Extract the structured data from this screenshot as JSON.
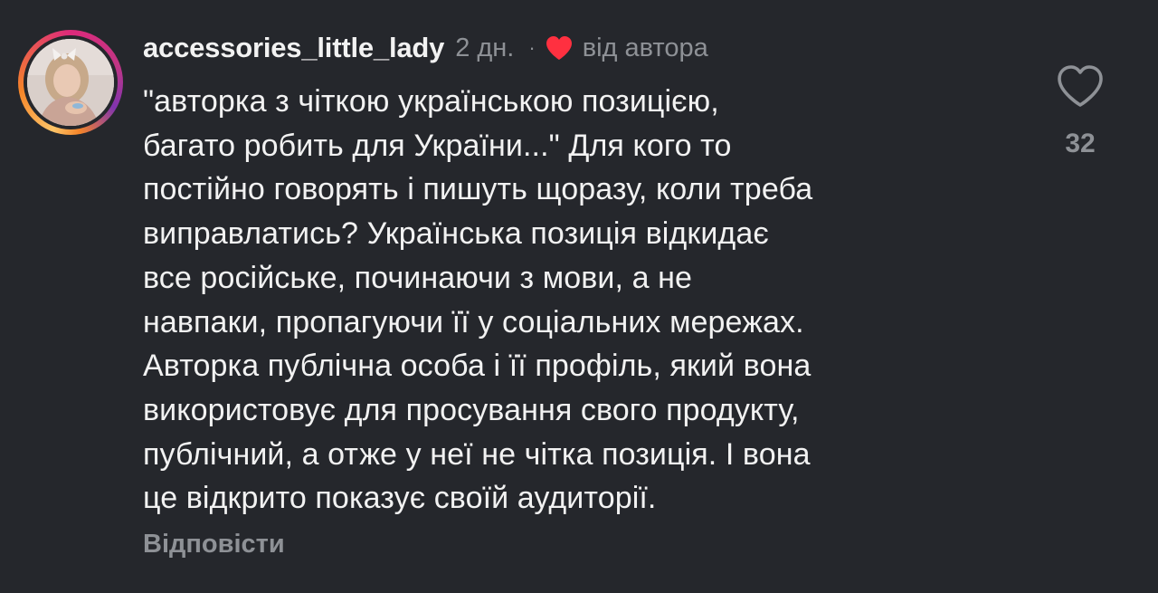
{
  "comment": {
    "username": "accessories_little_lady",
    "timestamp": "2 дн.",
    "separator": "·",
    "author_like_label": "від автора",
    "text": "\"авторка з чіткою українською позицією,\nбагато робить для України...\" Для кого то\nпостійно говорять і пишуть щоразу, коли треба\nвиправлатись? Українська позиція відкидає\nвсе російське, починаючи з мови, а не\nнавпаки, пропагуючи її у соціальних мережах.\nАвторка публічна особа і її профіль, який вона\nвикористовує для просування свого продукту,\nпублічний, а отже у неї не чітка позиція. І вона\nце відкрито показує своїй аудиторії.",
    "reply_label": "Відповісти",
    "like_count": "32"
  },
  "icons": {
    "author_heart": "heart-filled-icon",
    "like": "heart-outline-icon",
    "avatar": "profile-photo"
  },
  "colors": {
    "background": "#25272c",
    "text": "#f2f2f2",
    "muted": "#8e9196",
    "heart": "#ff3040"
  }
}
